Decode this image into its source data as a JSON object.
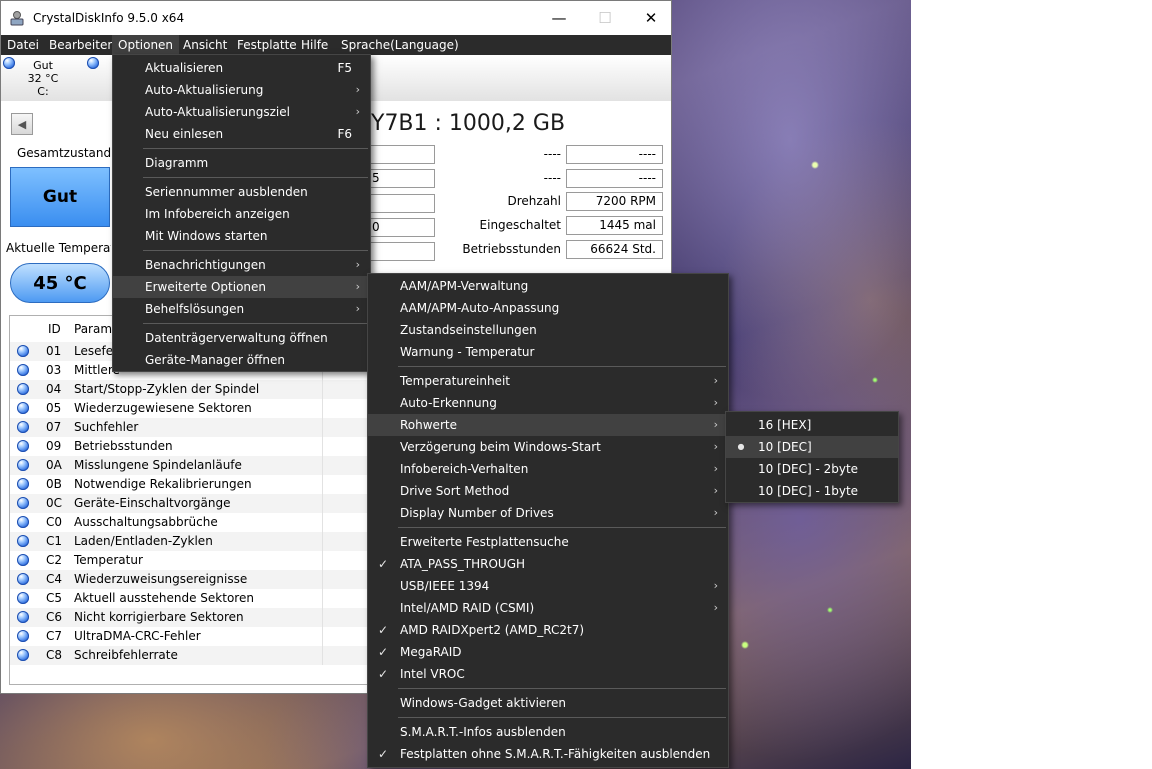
{
  "window": {
    "title": "CrystalDiskInfo 9.5.0 x64",
    "controls": {
      "minimize": "—",
      "maximize": "☐",
      "close": "✕"
    }
  },
  "menubar": [
    "Datei",
    "Bearbeiten",
    "Optionen",
    "Ansicht",
    "Festplatte",
    "Hilfe",
    "Sprache(Language)"
  ],
  "drives": [
    {
      "status": "Gut",
      "temp": "32 °C",
      "letter": "C:"
    }
  ],
  "disk": {
    "name_fragment": "Y7B1 : 1000,2 GB",
    "health_label": "Gesamtzustand",
    "health_value": "Gut",
    "temp_label": "Aktuelle Temperatu",
    "temp_value": "45 °C"
  },
  "info": {
    "left_values": [
      "5",
      "0"
    ],
    "rows": [
      {
        "label": "----",
        "value": "----"
      },
      {
        "label": "----",
        "value": "----"
      },
      {
        "label": "Drehzahl",
        "value": "7200 RPM"
      },
      {
        "label": "Eingeschaltet",
        "value": "1445 mal"
      },
      {
        "label": "Betriebsstunden",
        "value": "66624 Std."
      }
    ]
  },
  "smart": {
    "columns": [
      "ID",
      "Parame"
    ],
    "rows": [
      {
        "id": "01",
        "name": "Lesefeh"
      },
      {
        "id": "03",
        "name": "Mittlere"
      },
      {
        "id": "04",
        "name": "Start/Stopp-Zyklen der Spindel"
      },
      {
        "id": "05",
        "name": "Wiederzugewiesene Sektoren"
      },
      {
        "id": "07",
        "name": "Suchfehler"
      },
      {
        "id": "09",
        "name": "Betriebsstunden"
      },
      {
        "id": "0A",
        "name": "Misslungene Spindelanläufe"
      },
      {
        "id": "0B",
        "name": "Notwendige Rekalibrierungen"
      },
      {
        "id": "0C",
        "name": "Geräte-Einschaltvorgänge"
      },
      {
        "id": "C0",
        "name": "Ausschaltungsabbrüche"
      },
      {
        "id": "C1",
        "name": "Laden/Entladen-Zyklen"
      },
      {
        "id": "C2",
        "name": "Temperatur"
      },
      {
        "id": "C4",
        "name": "Wiederzuweisungsereignisse"
      },
      {
        "id": "C5",
        "name": "Aktuell ausstehende Sektoren"
      },
      {
        "id": "C6",
        "name": "Nicht korrigierbare Sektoren"
      },
      {
        "id": "C7",
        "name": "UltraDMA-CRC-Fehler"
      },
      {
        "id": "C8",
        "name": "Schreibfehlerrate"
      }
    ]
  },
  "menu_optionen": [
    {
      "label": "Aktualisieren",
      "shortcut": "F5"
    },
    {
      "label": "Auto-Aktualisierung",
      "submenu": true
    },
    {
      "label": "Auto-Aktualisierungsziel",
      "submenu": true
    },
    {
      "label": "Neu einlesen",
      "shortcut": "F6"
    },
    {
      "label": "Diagramm"
    },
    {
      "label": "Seriennummer ausblenden"
    },
    {
      "label": "Im Infobereich anzeigen"
    },
    {
      "label": "Mit Windows starten"
    },
    {
      "label": "Benachrichtigungen",
      "submenu": true
    },
    {
      "label": "Erweiterte Optionen",
      "submenu": true,
      "highlighted": true
    },
    {
      "label": "Behelfslösungen",
      "submenu": true
    },
    {
      "label": "Datenträgerverwaltung öffnen"
    },
    {
      "label": "Geräte-Manager öffnen"
    }
  ],
  "menu_erweitert": [
    {
      "label": "AAM/APM-Verwaltung"
    },
    {
      "label": "AAM/APM-Auto-Anpassung"
    },
    {
      "label": "Zustandseinstellungen"
    },
    {
      "label": "Warnung - Temperatur"
    },
    {
      "label": "Temperatureinheit",
      "submenu": true
    },
    {
      "label": "Auto-Erkennung",
      "submenu": true
    },
    {
      "label": "Rohwerte",
      "submenu": true,
      "highlighted": true
    },
    {
      "label": "Verzögerung beim Windows-Start",
      "submenu": true
    },
    {
      "label": "Infobereich-Verhalten",
      "submenu": true
    },
    {
      "label": "Drive Sort Method",
      "submenu": true
    },
    {
      "label": "Display Number of Drives",
      "submenu": true
    },
    {
      "label": "Erweiterte Festplattensuche"
    },
    {
      "label": "ATA_PASS_THROUGH",
      "checked": true
    },
    {
      "label": "USB/IEEE 1394",
      "submenu": true
    },
    {
      "label": "Intel/AMD RAID (CSMI)",
      "submenu": true
    },
    {
      "label": "AMD RAIDXpert2 (AMD_RC2t7)",
      "checked": true
    },
    {
      "label": "MegaRAID",
      "checked": true
    },
    {
      "label": "Intel VROC",
      "checked": true
    },
    {
      "label": "Windows-Gadget aktivieren"
    },
    {
      "label": "S.M.A.R.T.-Infos ausblenden"
    },
    {
      "label": "Festplatten ohne S.M.A.R.T.-Fähigkeiten ausblenden",
      "checked": true
    }
  ],
  "menu_rohwerte": [
    {
      "label": "16 [HEX]"
    },
    {
      "label": "10 [DEC]",
      "selected": true,
      "highlighted": true
    },
    {
      "label": "10 [DEC] - 2byte"
    },
    {
      "label": "10 [DEC] - 1byte"
    }
  ],
  "glyphs": {
    "arrow": "›",
    "check": "✓",
    "bullet": "●",
    "back": "◀"
  },
  "colors": {
    "menu_bg": "#2b2b2b",
    "menu_highlight": "#414141",
    "health_blue": "#3a8ef0"
  }
}
